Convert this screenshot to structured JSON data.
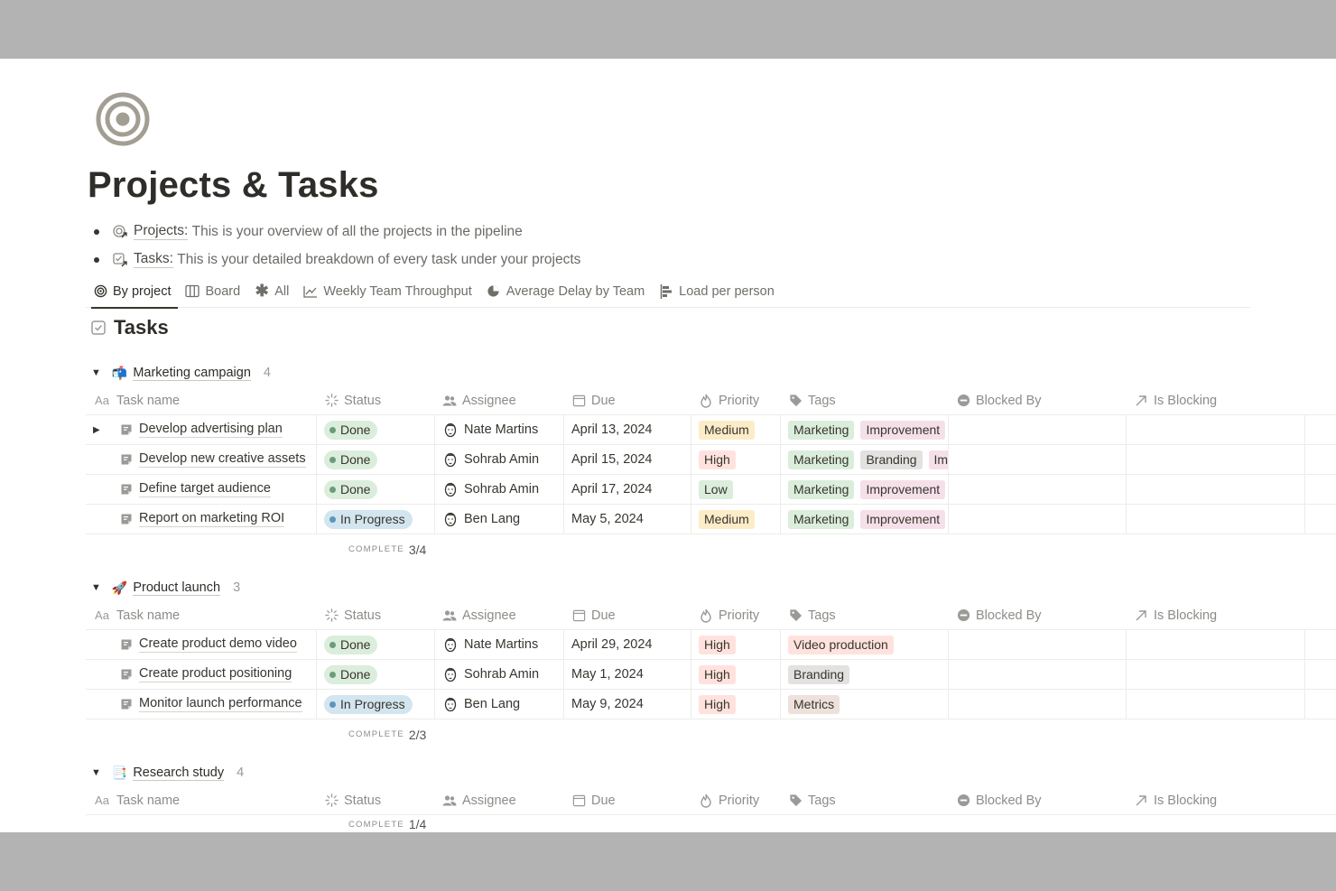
{
  "page": {
    "icon": "target-icon",
    "title": "Projects & Tasks",
    "bullets": [
      {
        "icon": "projects-page-icon",
        "link": "Projects:",
        "text": "This is your overview of all the projects in the pipeline"
      },
      {
        "icon": "tasks-page-icon",
        "link": "Tasks:",
        "text": "This is your detailed breakdown of every task under your projects"
      }
    ]
  },
  "tabs": [
    {
      "label": "By project",
      "icon": "target-icon",
      "active": true
    },
    {
      "label": "Board",
      "icon": "board-icon"
    },
    {
      "label": "All",
      "icon": "asterisk-icon"
    },
    {
      "label": "Weekly Team Throughput",
      "icon": "line-chart-icon"
    },
    {
      "label": "Average Delay by Team",
      "icon": "pie-chart-icon"
    },
    {
      "label": "Load per person",
      "icon": "bar-chart-icon"
    }
  ],
  "database": {
    "title": "Tasks",
    "icon": "checkbox-icon"
  },
  "columns": {
    "name": "Task name",
    "name_icon": "Aa",
    "status": "Status",
    "assignee": "Assignee",
    "due": "Due",
    "priority": "Priority",
    "tags": "Tags",
    "blocked_by": "Blocked By",
    "is_blocking": "Is Blocking"
  },
  "complete_label": "COMPLETE",
  "colors": {
    "done_bg": "#dbeddb",
    "done_dot": "#6c9b7d",
    "progress_bg": "#d3e5ef",
    "progress_dot": "#5b97bd",
    "medium_bg": "#fdecc8",
    "high_bg": "#ffe2dd",
    "low_bg": "#dbeddb",
    "tag_marketing": "#dbeddb",
    "tag_improvement": "#f5e0e9",
    "tag_branding": "#e3e2e0",
    "tag_video": "#ffe2dd",
    "tag_metrics": "#eee0da"
  },
  "groups": [
    {
      "emoji": "📬",
      "name": "Marketing campaign",
      "count": "4",
      "complete": "3/4",
      "rows": [
        {
          "name": "Develop advertising plan",
          "expandable": true,
          "status": "Done",
          "assignee": "Nate Martins",
          "due": "April 13, 2024",
          "priority": "Medium",
          "tags": [
            "Marketing",
            "Improvement"
          ]
        },
        {
          "name": "Develop new creative assets",
          "status": "Done",
          "assignee": "Sohrab Amin",
          "due": "April 15, 2024",
          "priority": "High",
          "tags": [
            "Marketing",
            "Branding",
            "Improvement"
          ]
        },
        {
          "name": "Define target audience",
          "status": "Done",
          "assignee": "Sohrab Amin",
          "due": "April 17, 2024",
          "priority": "Low",
          "tags": [
            "Marketing",
            "Improvement"
          ]
        },
        {
          "name": "Report on marketing ROI",
          "status": "In Progress",
          "assignee": "Ben Lang",
          "due": "May 5, 2024",
          "priority": "Medium",
          "tags": [
            "Marketing",
            "Improvement"
          ]
        }
      ]
    },
    {
      "emoji": "🚀",
      "name": "Product launch",
      "count": "3",
      "complete": "2/3",
      "rows": [
        {
          "name": "Create product demo video",
          "status": "Done",
          "assignee": "Nate Martins",
          "due": "April 29, 2024",
          "priority": "High",
          "tags": [
            "Video production"
          ]
        },
        {
          "name": "Create product positioning",
          "status": "Done",
          "assignee": "Sohrab Amin",
          "due": "May 1, 2024",
          "priority": "High",
          "tags": [
            "Branding"
          ]
        },
        {
          "name": "Monitor launch performance",
          "status": "In Progress",
          "assignee": "Ben Lang",
          "due": "May 9, 2024",
          "priority": "High",
          "tags": [
            "Metrics"
          ]
        }
      ]
    },
    {
      "emoji": "📑",
      "name": "Research study",
      "count": "4",
      "complete": "1/4",
      "rows": []
    }
  ]
}
